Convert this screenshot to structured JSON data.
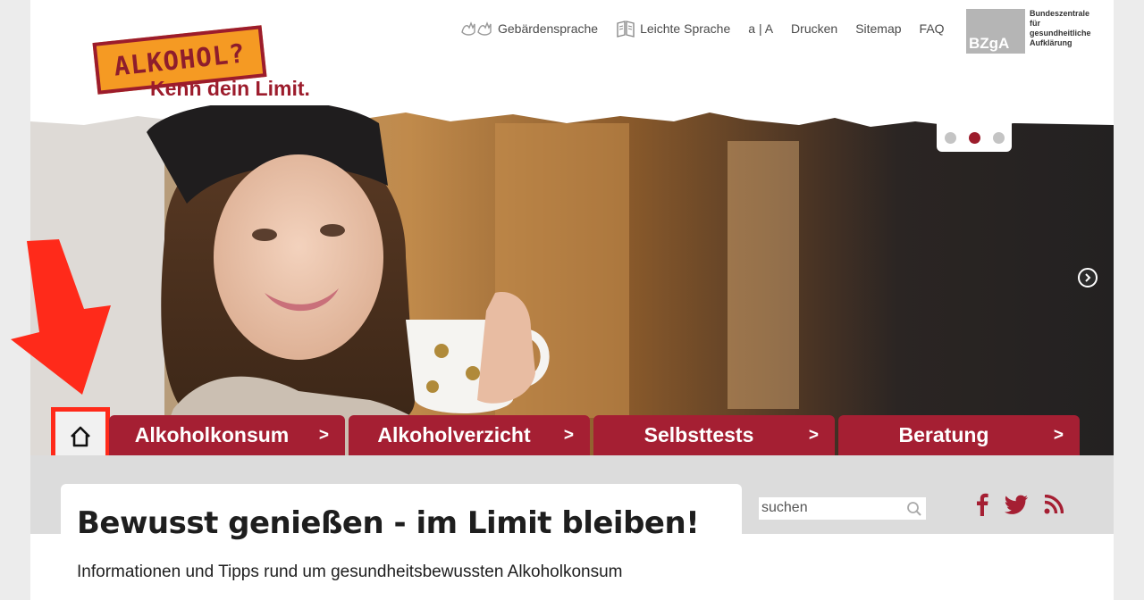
{
  "header": {
    "logo": {
      "stamp_text": "ALKOHOL?",
      "tagline": "Kenn dein Limit."
    },
    "topnav": [
      {
        "label": "Gebärdensprache",
        "icon": "sign-language-icon"
      },
      {
        "label": "Leichte Sprache",
        "icon": "easy-language-book-icon"
      },
      {
        "label": "a | A"
      },
      {
        "label": "Drucken"
      },
      {
        "label": "Sitemap"
      },
      {
        "label": "FAQ"
      }
    ],
    "bzga": {
      "box_text": "BZgA",
      "lines": [
        "Bundeszentrale",
        "für",
        "gesundheitliche",
        "Aufklärung"
      ]
    }
  },
  "slider": {
    "dots": 3,
    "active_dot": 2,
    "next_icon": "chevron-right-circle-icon"
  },
  "nav": {
    "home_icon": "home-icon",
    "items": [
      {
        "label": "Alkoholkonsum",
        "chevron": ">"
      },
      {
        "label": "Alkoholverzicht",
        "chevron": ">"
      },
      {
        "label": "Selbsttests",
        "chevron": ">"
      },
      {
        "label": "Beratung",
        "chevron": ">"
      }
    ]
  },
  "main": {
    "title": "Bewusst genießen - im Limit bleiben!",
    "subtitle": "Informationen und Tipps rund um gesundheitsbewussten Alkoholkonsum"
  },
  "search": {
    "placeholder": "suchen",
    "icon": "search-icon"
  },
  "social": [
    {
      "icon": "facebook-icon"
    },
    {
      "icon": "twitter-icon"
    },
    {
      "icon": "rss-icon"
    }
  ],
  "colors": {
    "brand_red": "#a51f33",
    "logo_orange": "#f59a23",
    "annotation_red": "#ff2a1a",
    "content_grey": "#dcdcdc"
  }
}
